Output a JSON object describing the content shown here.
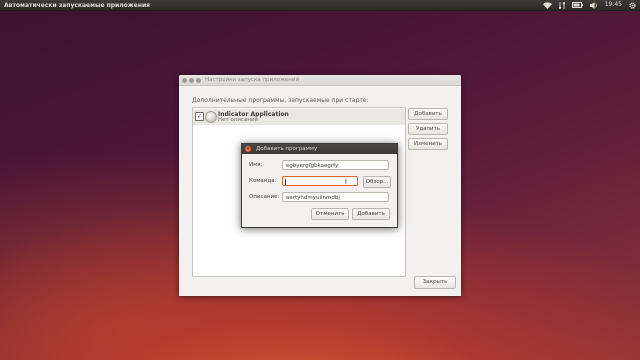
{
  "panel": {
    "app_title": "Автоматически запускаемые приложения",
    "icons": [
      "network-wifi-icon",
      "sort-icon",
      "battery-icon",
      "volume-icon"
    ],
    "clock": "19:45",
    "gear_icon": "gear-icon"
  },
  "window": {
    "title": "Настройки запуска приложений",
    "heading": "Дополнительные программы, запускаемые при старте:",
    "items": [
      {
        "checked": true,
        "name": "Indicator Application",
        "description": "Нет описания",
        "icon": "application-icon"
      }
    ],
    "buttons": {
      "add": "Добавить",
      "remove": "Удалить",
      "edit": "Изменить"
    },
    "close_label": "Закрыть"
  },
  "dialog": {
    "title": "Добавить программу",
    "name_label": "Имя:",
    "name_value": "egbyergfgbkaegrfy",
    "command_label": "Команда:",
    "command_value": "",
    "browse_label": "Обзор...",
    "description_label": "Описание:",
    "description_value": "aertyhdmyuiinmdbj",
    "cancel_label": "Отменить",
    "add_label": "Добавить"
  },
  "colors": {
    "accent": "#df4b16",
    "panel": "#3c3b37"
  }
}
